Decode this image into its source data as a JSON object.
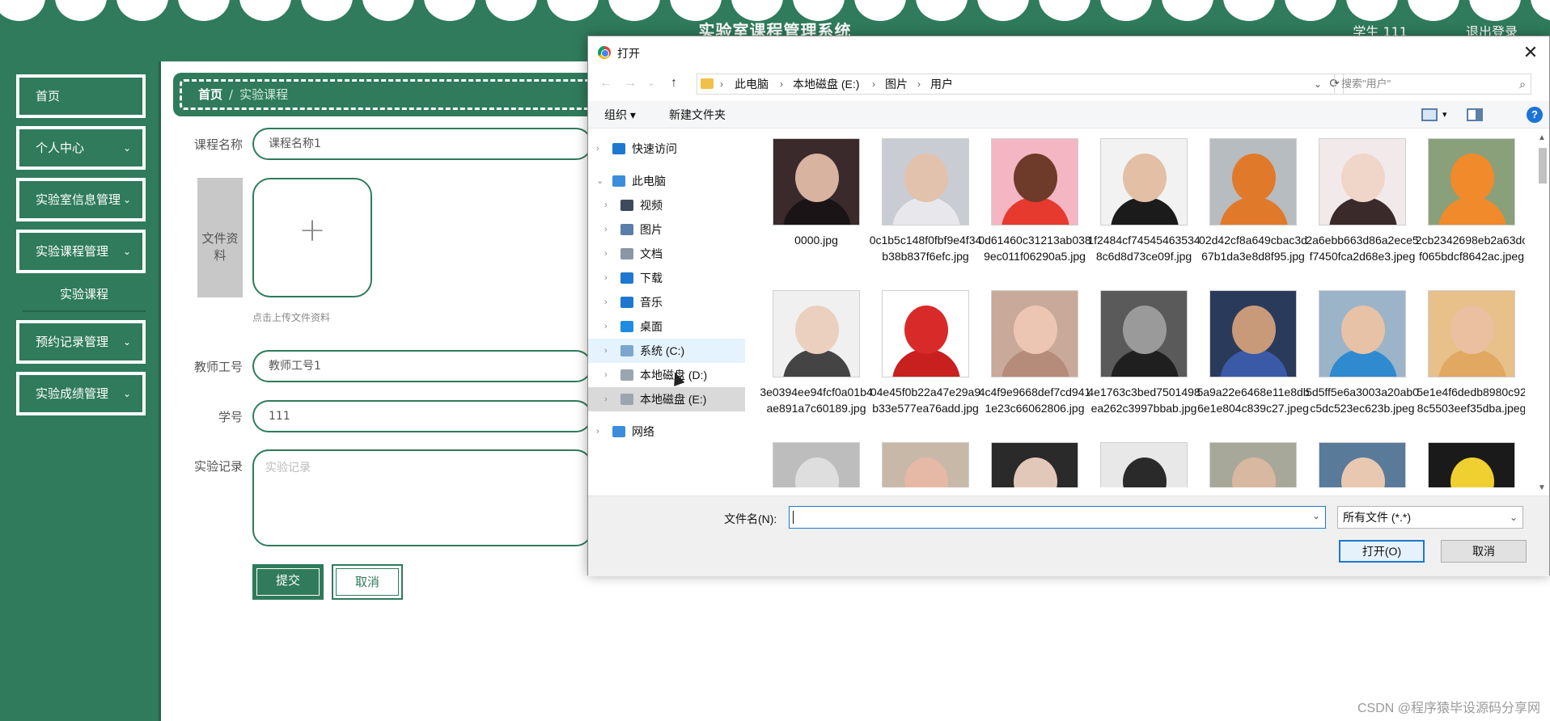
{
  "header": {
    "title": "实验室课程管理系统",
    "user": "学生 111",
    "logout": "退出登录"
  },
  "sidebar": {
    "items": [
      {
        "label": "首页",
        "has_children": false
      },
      {
        "label": "个人中心",
        "has_children": true
      },
      {
        "label": "实验室信息管理",
        "has_children": true
      },
      {
        "label": "实验课程管理",
        "has_children": true
      },
      {
        "label": "预约记录管理",
        "has_children": true
      },
      {
        "label": "实验成绩管理",
        "has_children": true
      }
    ],
    "sub_item": "实验课程",
    "chevron": "⌄"
  },
  "breadcrumb": {
    "home": "首页",
    "separator": "/",
    "current": "实验课程"
  },
  "form": {
    "course_name_label": "课程名称",
    "course_name_value": "课程名称1",
    "file_label": "文件资料",
    "upload_plus": "+",
    "upload_tip": "点击上传文件资料",
    "teacher_label": "教师工号",
    "teacher_value": "教师工号1",
    "student_label": "学号",
    "student_value": "111",
    "record_label": "实验记录",
    "record_placeholder": "实验记录",
    "submit": "提交",
    "cancel": "取消"
  },
  "dialog": {
    "title": "打开",
    "close": "✕",
    "nav": {
      "back": "←",
      "forward": "→",
      "recent": "⌄",
      "up": "↑"
    },
    "address": [
      "此电脑",
      "本地磁盘 (E:)",
      "图片",
      "用户"
    ],
    "address_sep": "›",
    "search_placeholder": "搜索\"用户\"",
    "toolbar": {
      "organize": "组织 ▾",
      "new_folder": "新建文件夹",
      "view_dd": "▾",
      "help": "?"
    },
    "tree": [
      {
        "label": "快速访问",
        "level": 0,
        "expand": "›",
        "icon": "star-icon",
        "color": "#1e78d0"
      },
      {
        "label": "此电脑",
        "level": 0,
        "expand": "⌄",
        "icon": "computer-icon",
        "color": "#3b8ddb"
      },
      {
        "label": "视频",
        "level": 1,
        "expand": "›",
        "icon": "video-icon",
        "color": "#3d4a5c"
      },
      {
        "label": "图片",
        "level": 1,
        "expand": "›",
        "icon": "pictures-icon",
        "color": "#5a7fa8"
      },
      {
        "label": "文档",
        "level": 1,
        "expand": "›",
        "icon": "documents-icon",
        "color": "#8a96a3"
      },
      {
        "label": "下载",
        "level": 1,
        "expand": "›",
        "icon": "download-icon",
        "color": "#1e78d0"
      },
      {
        "label": "音乐",
        "level": 1,
        "expand": "›",
        "icon": "music-icon",
        "color": "#1e78d0"
      },
      {
        "label": "桌面",
        "level": 1,
        "expand": "›",
        "icon": "desktop-icon",
        "color": "#1e8ce0"
      },
      {
        "label": "系统 (C:)",
        "level": 1,
        "expand": "›",
        "icon": "drive-icon",
        "color": "#7aa6cf"
      },
      {
        "label": "本地磁盘 (D:)",
        "level": 1,
        "expand": "›",
        "icon": "drive-icon",
        "color": "#9aa5b0"
      },
      {
        "label": "本地磁盘 (E:)",
        "level": 1,
        "expand": "›",
        "icon": "drive-icon",
        "color": "#9aa5b0"
      },
      {
        "label": "网络",
        "level": 0,
        "expand": "›",
        "icon": "network-icon",
        "color": "#3b8ddb"
      }
    ],
    "files": [
      {
        "name": "0000.jpg",
        "bg": "#3a2a2c",
        "skin": "#d8b3a0",
        "cloth": "#1a1416"
      },
      {
        "name": "0c1b5c148f0fbf9e4f34b38b837f6efc.jpg",
        "bg": "#c9ccd3",
        "skin": "#e2c2ad",
        "cloth": "#e8e8ec"
      },
      {
        "name": "0d61460c31213ab0389ec011f06290a5.jpg",
        "bg": "#f4b6c2",
        "skin": "#6e3b2a",
        "cloth": "#e63a2e"
      },
      {
        "name": "1f2484cf745454635348c6d8d73ce09f.jpg",
        "bg": "#f2f2f2",
        "skin": "#e3bfa5",
        "cloth": "#1b1b1b"
      },
      {
        "name": "02d42cf8a649cbac3d67b1da3e8d8f95.jpg",
        "bg": "#b7bcc0",
        "skin": "#e07a2a",
        "cloth": "#e07a2a"
      },
      {
        "name": "2a6ebb663d86a2ece5f7450fca2d68e3.jpeg",
        "bg": "#f2e9ea",
        "skin": "#f0d6c8",
        "cloth": "#3a2a2a"
      },
      {
        "name": "2cb2342698eb2a63dcf065bdcf8642ac.jpeg",
        "bg": "#8aa07a",
        "skin": "#f08a2a",
        "cloth": "#f08a2a"
      },
      {
        "name": "3e0394ee94fcf0a01b4ae891a7c60189.jpg",
        "bg": "#f0f0f0",
        "skin": "#ecd0bf",
        "cloth": "#444444"
      },
      {
        "name": "04e45f0b22a47e29a9b33e577ea76add.jpg",
        "bg": "#ffffff",
        "skin": "#d92a2a",
        "cloth": "#c81f1f"
      },
      {
        "name": "4c4f9e9668def7cd9411e23c66062806.jpg",
        "bg": "#c9a99a",
        "skin": "#ecc6b2",
        "cloth": "#b58b7a"
      },
      {
        "name": "4e1763c3bed7501498ea262c3997bbab.jpg",
        "bg": "#5a5a5a",
        "skin": "#9a9a9a",
        "cloth": "#1f1f1f"
      },
      {
        "name": "5a9a22e6468e11e8db6e1e804c839c27.jpeg",
        "bg": "#2a3a5a",
        "skin": "#c89a7a",
        "cloth": "#3a5aa8"
      },
      {
        "name": "5d5ff5e6a3003a20ab0c5dc523ec623b.jpeg",
        "bg": "#9cb4c8",
        "skin": "#e8c2a6",
        "cloth": "#2f8ad0"
      },
      {
        "name": "5e1e4f6dedb8980c928c5503eef35dba.jpeg",
        "bg": "#e7c08a",
        "skin": "#eac0a0",
        "cloth": "#e0a860"
      },
      {
        "name": "",
        "bg": "#bdbdbd",
        "skin": "#dedede",
        "cloth": "#6a6a6a"
      },
      {
        "name": "",
        "bg": "#c8b8a8",
        "skin": "#e6b8a6",
        "cloth": "#8a7a6a"
      },
      {
        "name": "",
        "bg": "#2a2a2a",
        "skin": "#e2c8b8",
        "cloth": "#1a1a1a"
      },
      {
        "name": "",
        "bg": "#e8e8e8",
        "skin": "#2a2a2a",
        "cloth": "#111111"
      },
      {
        "name": "",
        "bg": "#a8a89a",
        "skin": "#d8b8a0",
        "cloth": "#5a5a4a"
      },
      {
        "name": "",
        "bg": "#5a7a9a",
        "skin": "#e8c8b0",
        "cloth": "#2a3a5a"
      },
      {
        "name": "",
        "bg": "#1a1a1a",
        "skin": "#f0d030",
        "cloth": "#f0c020"
      }
    ],
    "filename_label": "文件名(N):",
    "filename_value": "",
    "filetype": "所有文件 (*.*)",
    "open": "打开(O)",
    "cancel": "取消"
  },
  "watermark": "CSDN @程序猿毕设源码分享网",
  "colors": {
    "primary": "#2f7b5b",
    "primary_dark": "#24654a",
    "dialog_accent": "#1e78d0"
  }
}
